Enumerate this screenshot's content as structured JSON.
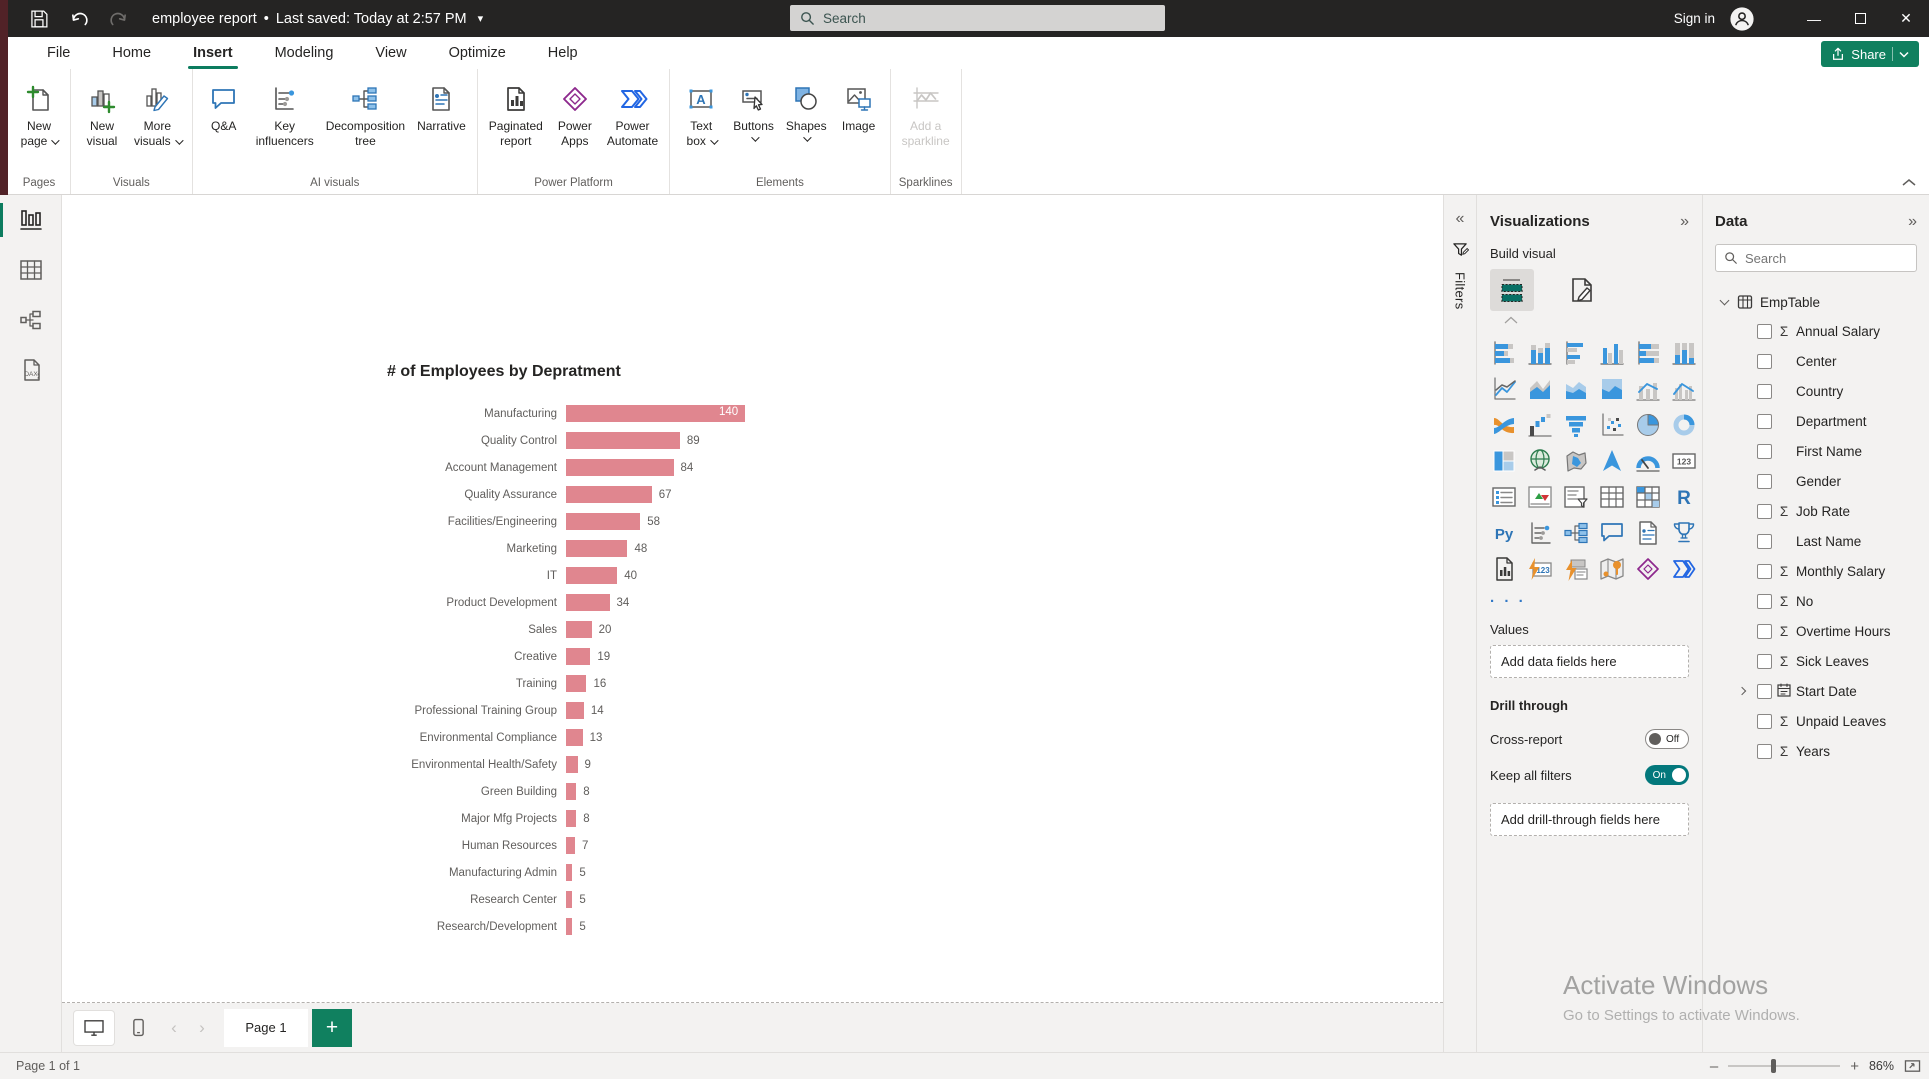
{
  "titlebar": {
    "title": "employee report",
    "separator": "•",
    "saved": "Last saved: Today at 2:57 PM",
    "search_placeholder": "Search",
    "sign_in": "Sign in"
  },
  "menubar": {
    "tabs": [
      {
        "label": "File",
        "active": false
      },
      {
        "label": "Home",
        "active": false
      },
      {
        "label": "Insert",
        "active": true
      },
      {
        "label": "Modeling",
        "active": false
      },
      {
        "label": "View",
        "active": false
      },
      {
        "label": "Optimize",
        "active": false
      },
      {
        "label": "Help",
        "active": false
      }
    ],
    "share_label": "Share"
  },
  "ribbon": {
    "groups": [
      {
        "label": "Pages",
        "items": [
          {
            "icon": "new-page-icon",
            "lines": [
              "New",
              "page"
            ],
            "chevron": true
          }
        ]
      },
      {
        "label": "Visuals",
        "items": [
          {
            "icon": "new-visual-icon",
            "lines": [
              "New",
              "visual"
            ]
          },
          {
            "icon": "more-visuals-icon",
            "lines": [
              "More",
              "visuals"
            ],
            "chevron": true
          }
        ]
      },
      {
        "label": "AI visuals",
        "items": [
          {
            "icon": "qa-icon",
            "lines": [
              "Q&A"
            ]
          },
          {
            "icon": "key-influencers-icon",
            "lines": [
              "Key",
              "influencers"
            ]
          },
          {
            "icon": "decomposition-tree-icon",
            "lines": [
              "Decomposition",
              "tree"
            ]
          },
          {
            "icon": "narrative-icon",
            "lines": [
              "Narrative"
            ]
          }
        ]
      },
      {
        "label": "Power Platform",
        "items": [
          {
            "icon": "paginated-report-icon",
            "lines": [
              "Paginated",
              "report"
            ]
          },
          {
            "icon": "power-apps-icon",
            "lines": [
              "Power",
              "Apps"
            ]
          },
          {
            "icon": "power-automate-icon",
            "lines": [
              "Power",
              "Automate"
            ]
          }
        ]
      },
      {
        "label": "Elements",
        "items": [
          {
            "icon": "text-box-icon",
            "lines": [
              "Text",
              "box"
            ],
            "chevron": true
          },
          {
            "icon": "buttons-icon",
            "lines": [
              "Buttons"
            ],
            "chevron": true
          },
          {
            "icon": "shapes-icon",
            "lines": [
              "Shapes"
            ],
            "chevron": true
          },
          {
            "icon": "image-icon",
            "lines": [
              "Image"
            ]
          }
        ]
      },
      {
        "label": "Sparklines",
        "items": [
          {
            "icon": "sparkline-icon",
            "lines": [
              "Add a",
              "sparkline"
            ],
            "disabled": true
          }
        ]
      }
    ]
  },
  "sidebar": {
    "items": [
      {
        "name": "report-view",
        "selected": true
      },
      {
        "name": "table-view",
        "selected": false
      },
      {
        "name": "model-view",
        "selected": false
      },
      {
        "name": "dax-query-view",
        "selected": false
      }
    ]
  },
  "chart_data": {
    "type": "bar",
    "orientation": "horizontal",
    "title": "# of Employees by Depratment",
    "categories": [
      "Manufacturing",
      "Quality Control",
      "Account Management",
      "Quality Assurance",
      "Facilities/Engineering",
      "Marketing",
      "IT",
      "Product Development",
      "Sales",
      "Creative",
      "Training",
      "Professional Training Group",
      "Environmental Compliance",
      "Environmental Health/Safety",
      "Green Building",
      "Major Mfg Projects",
      "Human Resources",
      "Manufacturing Admin",
      "Research Center",
      "Research/Development"
    ],
    "values": [
      140,
      89,
      84,
      67,
      58,
      48,
      40,
      34,
      20,
      19,
      16,
      14,
      13,
      9,
      8,
      8,
      7,
      5,
      5,
      5
    ],
    "xlim": [
      0,
      140
    ],
    "bar_color": "#E0868F",
    "value_labels": true,
    "legend": "none",
    "grid": false
  },
  "filters_pane": {
    "label": "Filters"
  },
  "visualizations": {
    "title": "Visualizations",
    "build_visual_label": "Build visual",
    "visual_icons": [
      "stacked-bar-chart",
      "stacked-column-chart",
      "clustered-bar-chart",
      "clustered-column-chart",
      "100-stacked-bar-chart",
      "100-stacked-column-chart",
      "line-chart",
      "area-chart",
      "stacked-area-chart",
      "100-stacked-area-chart",
      "line-and-stacked-column-chart",
      "line-and-clustered-column-chart",
      "ribbon-chart",
      "waterfall-chart",
      "funnel-chart",
      "scatter-chart",
      "pie-chart",
      "donut-chart",
      "treemap",
      "map",
      "filled-map",
      "azure-map",
      "gauge",
      "card",
      "multi-row-card",
      "kpi",
      "slicer",
      "table",
      "matrix",
      "r-script-visual",
      "python-visual",
      "key-influencers-visual",
      "decomposition-tree-visual",
      "qna-visual",
      "smart-narrative",
      "metrics",
      "paginated-report-visual",
      "quick-measure",
      "dynamic-parameter",
      "arcgis-map",
      "power-apps-visual",
      "power-automate-visual"
    ],
    "more_label": ". . .",
    "values_label": "Values",
    "values_placeholder": "Add data fields here",
    "drill_through_label": "Drill through",
    "cross_report_label": "Cross-report",
    "cross_report_state": "Off",
    "keep_filters_label": "Keep all filters",
    "keep_filters_state": "On",
    "drill_placeholder": "Add drill-through fields here"
  },
  "data_panel": {
    "title": "Data",
    "search_placeholder": "Search",
    "table": {
      "name": "EmpTable",
      "fields": [
        {
          "name": "Annual Salary",
          "numeric": true
        },
        {
          "name": "Center",
          "numeric": false
        },
        {
          "name": "Country",
          "numeric": false
        },
        {
          "name": "Department",
          "numeric": false
        },
        {
          "name": "First Name",
          "numeric": false
        },
        {
          "name": "Gender",
          "numeric": false
        },
        {
          "name": "Job Rate",
          "numeric": true
        },
        {
          "name": "Last Name",
          "numeric": false
        },
        {
          "name": "Monthly Salary",
          "numeric": true
        },
        {
          "name": "No",
          "numeric": true
        },
        {
          "name": "Overtime Hours",
          "numeric": true
        },
        {
          "name": "Sick Leaves",
          "numeric": true
        },
        {
          "name": "Start Date",
          "numeric": false,
          "date": true,
          "expandable": true
        },
        {
          "name": "Unpaid Leaves",
          "numeric": true
        },
        {
          "name": "Years",
          "numeric": true
        }
      ]
    }
  },
  "page_tabs": {
    "tabs": [
      {
        "label": "Page 1",
        "active": true
      }
    ]
  },
  "statusbar": {
    "page_indicator": "Page 1 of 1",
    "zoom_level": "86%"
  },
  "watermark": {
    "line1": "Activate Windows",
    "line2": "Go to Settings to activate Windows."
  },
  "colors": {
    "accent_green": "#10805F",
    "toggle_teal": "#03787C",
    "bar_pink": "#E0868F",
    "titlebar_dark": "#252423",
    "insert_underline": "#0C7C5F"
  }
}
